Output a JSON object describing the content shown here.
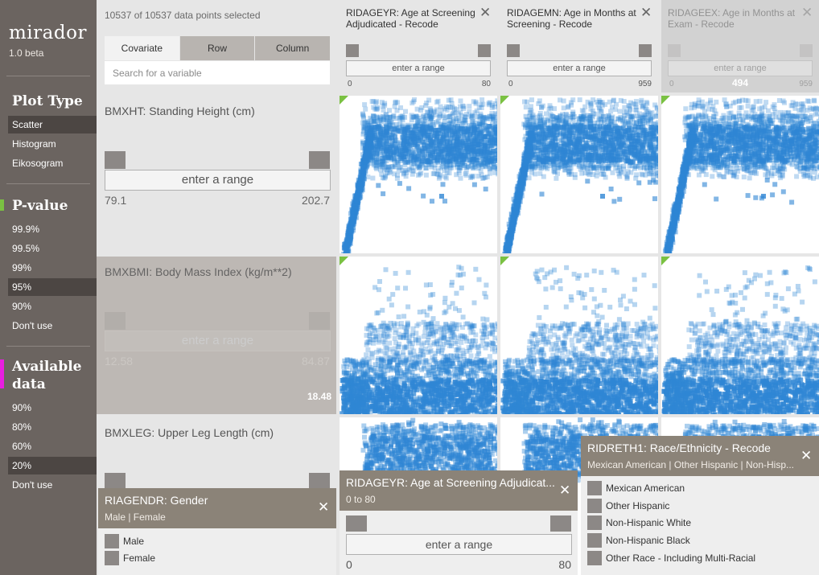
{
  "app": {
    "name": "mirador",
    "version": "1.0 beta"
  },
  "sidebar": {
    "plot_type": {
      "title": "Plot Type",
      "options": [
        "Scatter",
        "Histogram",
        "Eikosogram"
      ],
      "selected": 0
    },
    "pvalue": {
      "title": "P-value",
      "color": "#7ac142",
      "options": [
        "99.9%",
        "99.5%",
        "99%",
        "95%",
        "90%",
        "Don't use"
      ],
      "selected": 3
    },
    "available": {
      "title_line1": "Available",
      "title_line2": "data",
      "color": "#e81ee0",
      "options": [
        "90%",
        "80%",
        "60%",
        "20%",
        "Don't use"
      ],
      "selected": 3
    }
  },
  "header": {
    "count": "10537 of 10537 data points selected",
    "tabs": [
      "Covariate",
      "Row",
      "Column"
    ],
    "active_tab": 0,
    "search_placeholder": "Search for a variable"
  },
  "columns": [
    {
      "title": "RIDAGEYR: Age at Screening Adjudicated - Recode",
      "range_placeholder": "enter a range",
      "min": "0",
      "max": "80"
    },
    {
      "title": "RIDAGEMN: Age in Months at Screening - Recode",
      "range_placeholder": "enter a range",
      "min": "0",
      "max": "959"
    },
    {
      "title": "RIDAGEEX: Age in Months at Exam - Recode",
      "range_placeholder": "enter a range",
      "min": "0",
      "max": "959",
      "hover_value": "494"
    }
  ],
  "rows": [
    {
      "title": "BMXHT: Standing Height (cm)",
      "range_placeholder": "enter a range",
      "min": "79.1",
      "max": "202.7"
    },
    {
      "title": "BMXBMI: Body Mass Index (kg/m**2)",
      "range_placeholder": "enter a range",
      "min": "12.58",
      "max": "84.87",
      "hover_value": "18.48"
    },
    {
      "title": "BMXLEG: Upper Leg Length (cm)"
    }
  ],
  "plots": {
    "point_color": "#2f86d4",
    "pvalue_marker_color": "#7ac142"
  },
  "filters": {
    "gender": {
      "title": "RIAGENDR: Gender",
      "subtitle": "Male | Female",
      "options": [
        "Male",
        "Female"
      ]
    },
    "age": {
      "title": "RIDAGEYR: Age at Screening Adjudicat...",
      "subtitle": "0 to 80",
      "range_placeholder": "enter a range",
      "min": "0",
      "max": "80"
    },
    "race": {
      "title": "RIDRETH1: Race/Ethnicity - Recode",
      "subtitle": "Mexican American | Other Hispanic | Non-Hisp...",
      "options": [
        "Mexican American",
        "Other Hispanic",
        "Non-Hispanic White",
        "Non-Hispanic Black",
        "Other Race - Including Multi-Racial"
      ]
    }
  }
}
